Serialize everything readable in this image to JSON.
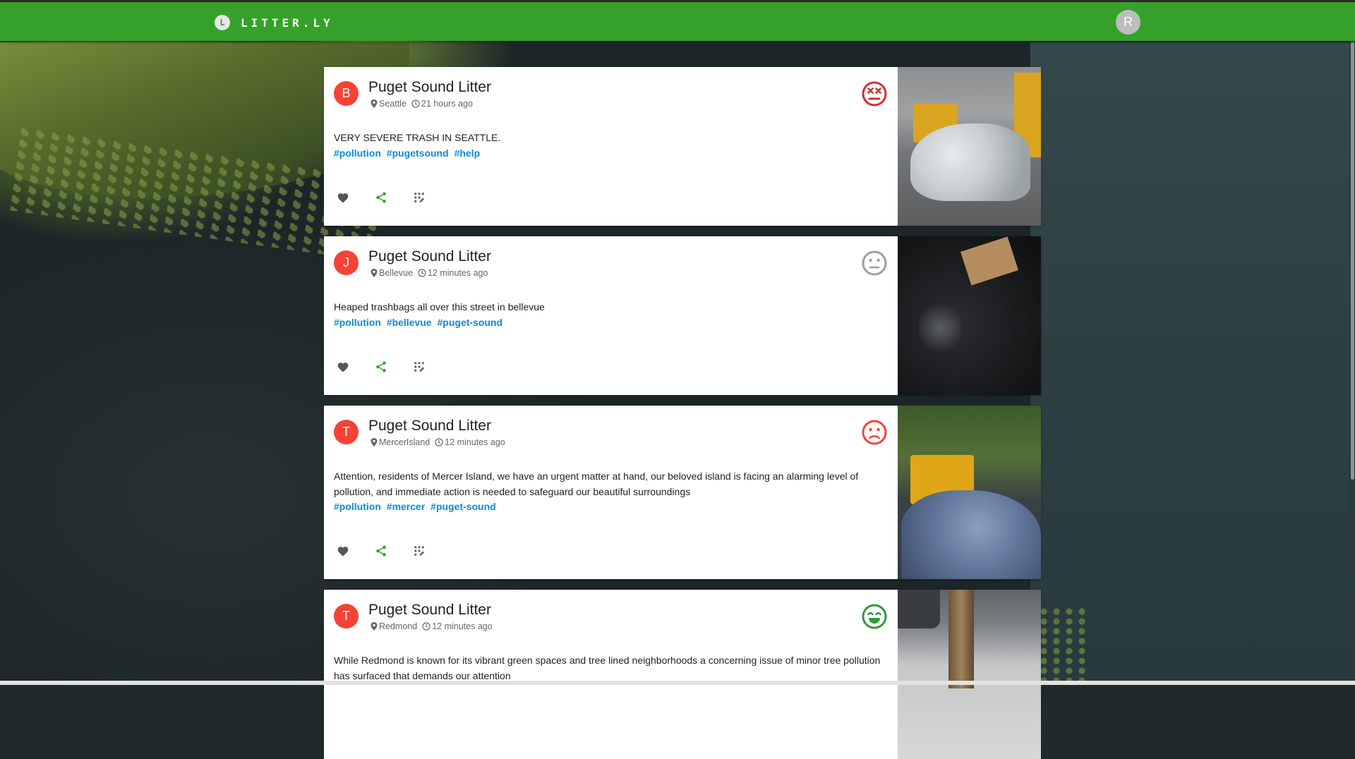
{
  "app": {
    "logo_letter": "L",
    "name": "LITTER.LY",
    "user_initial": "R",
    "brand_color": "#36a12a"
  },
  "posts": [
    {
      "avatar": "B",
      "title": "Puget Sound Litter",
      "location": "Seattle",
      "time": "21 hours ago",
      "mood": "dead-face-icon",
      "mood_color": "#d32f2f",
      "text": "VERY SEVERE TRASH IN SEATTLE.",
      "tags": [
        "#pollution",
        "#pugetsound",
        "#help"
      ]
    },
    {
      "avatar": "J",
      "title": "Puget Sound Litter",
      "location": "Bellevue",
      "time": "12 minutes ago",
      "mood": "neutral-face-icon",
      "mood_color": "#9e9e9e",
      "text": "Heaped trashbags all over this street in bellevue",
      "tags": [
        "#pollution",
        "#bellevue",
        "#puget-sound"
      ]
    },
    {
      "avatar": "T",
      "title": "Puget Sound Litter",
      "location": "MercerIsland",
      "time": "12 minutes ago",
      "mood": "sad-face-icon",
      "mood_color": "#f44336",
      "text": "Attention, residents of Mercer Island, we have an urgent matter at hand, our beloved island is facing an alarming level of pollution, and immediate action is needed to safeguard our beautiful surroundings",
      "tags": [
        "#pollution",
        "#mercer",
        "#puget-sound"
      ]
    },
    {
      "avatar": "T",
      "title": "Puget Sound Litter",
      "location": "Redmond",
      "time": "12 minutes ago",
      "mood": "happy-face-icon",
      "mood_color": "#2e9b3a",
      "text": "While Redmond is known for its vibrant green spaces and tree lined neighborhoods a concerning issue of minor tree pollution has surfaced that demands our attention",
      "tags": []
    }
  ],
  "actions": {
    "like_icon": "heart-icon",
    "share_icon": "share-icon",
    "more_icon": "grid-edit-icon",
    "like_color": "#555555",
    "share_color": "#36a12a"
  }
}
